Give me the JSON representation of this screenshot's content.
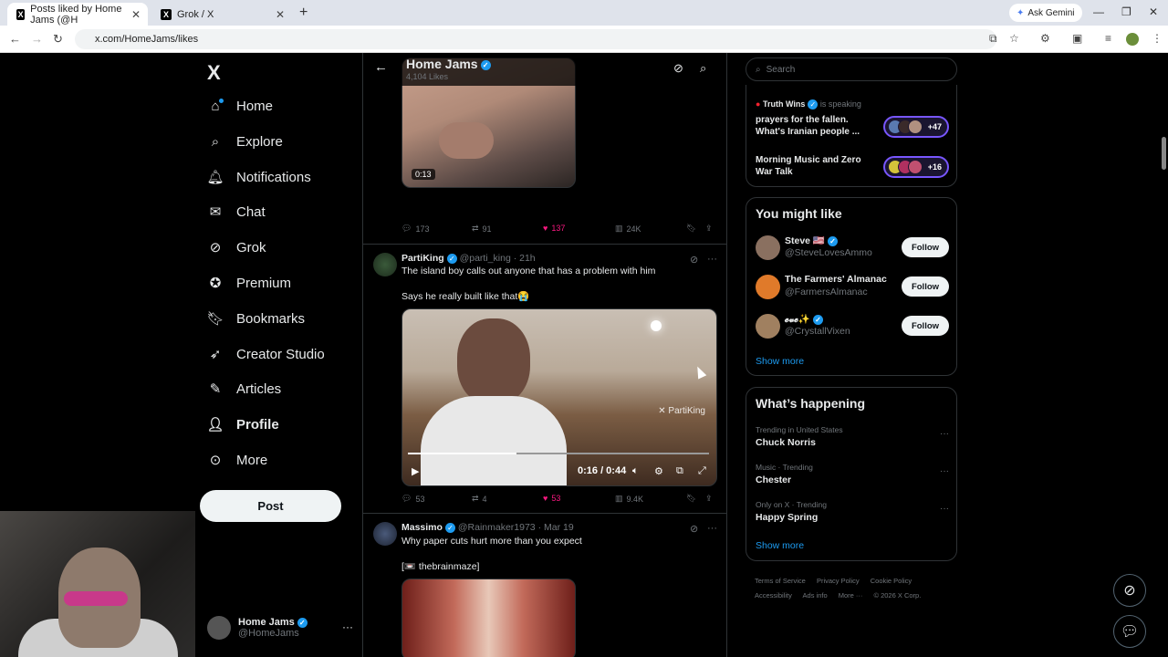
{
  "browser": {
    "tabs": [
      {
        "label": "Posts liked by Home Jams (@H"
      },
      {
        "label": "Grok / X"
      }
    ],
    "new_tab_icon": "plus-icon",
    "ask_gemini": "Ask Gemini",
    "url": "x.com/HomeJams/likes"
  },
  "nav": {
    "logo": "X",
    "items": [
      {
        "label": "Home",
        "icon": "home-icon"
      },
      {
        "label": "Explore",
        "icon": "search-icon"
      },
      {
        "label": "Notifications",
        "icon": "bell-icon"
      },
      {
        "label": "Chat",
        "icon": "mail-icon"
      },
      {
        "label": "Grok",
        "icon": "grok-icon"
      },
      {
        "label": "Premium",
        "icon": "verified-icon"
      },
      {
        "label": "Bookmarks",
        "icon": "bookmark-icon"
      },
      {
        "label": "Creator Studio",
        "icon": "rocket-icon"
      },
      {
        "label": "Articles",
        "icon": "article-icon"
      },
      {
        "label": "Profile",
        "icon": "person-icon"
      },
      {
        "label": "More",
        "icon": "more-circle-icon"
      }
    ],
    "post_button": "Post",
    "account": {
      "name": "Home Jams",
      "handle": "@HomeJams"
    }
  },
  "header": {
    "title": "Home Jams",
    "subtitle": "4,104 Likes"
  },
  "tweets": [
    {
      "duration": "0:13",
      "replies": "173",
      "reposts": "91",
      "likes": "137",
      "views": "24K"
    },
    {
      "name": "PartiKing",
      "handle": "@parti_king",
      "time": "21h",
      "text1": "The island boy calls out anyone that has a problem with him",
      "text2": "Says he really built like that😭",
      "watermark": "PartiKing",
      "time_display": "0:16 / 0:44",
      "video_progress": 0.36,
      "replies": "53",
      "reposts": "4",
      "likes": "53",
      "views": "9.4K"
    },
    {
      "name": "Massimo",
      "handle": "@Rainmaker1973",
      "time": "Mar 19",
      "text1": "Why paper cuts hurt more than you expect",
      "text2": "[📼 thebrainmaze]"
    }
  ],
  "sidebar": {
    "search_placeholder": "Search",
    "spaces": {
      "host": "Truth Wins",
      "status": "is speaking",
      "items": [
        {
          "title": "prayers for the fallen. What's Iranian people ...",
          "count": "+47"
        },
        {
          "title": "Morning Music and Zero War Talk",
          "count": "+16"
        }
      ]
    },
    "who_to_follow": {
      "title": "You might like",
      "users": [
        {
          "name": "Steve 🇺🇸",
          "handle": "@SteveLovesAmmo",
          "button": "Follow"
        },
        {
          "name": "The Farmers' Almanac",
          "handle": "@FarmersAlmanac",
          "button": "Follow"
        },
        {
          "name": "𝓮𝓿𝓮✨",
          "handle": "@CrystallVixen",
          "button": "Follow"
        }
      ],
      "show_more": "Show more"
    },
    "trends": {
      "title": "What’s happening",
      "items": [
        {
          "context": "Trending in United States",
          "name": "Chuck Norris"
        },
        {
          "context": "Music · Trending",
          "name": "Chester"
        },
        {
          "context": "Only on X · Trending",
          "name": "Happy Spring"
        }
      ],
      "show_more": "Show more"
    },
    "footer": [
      "Terms of Service",
      "Privacy Policy",
      "Cookie Policy",
      "Accessibility",
      "Ads info",
      "More ···",
      "© 2026 X Corp."
    ]
  },
  "colors": {
    "accent": "#1d9bf0",
    "like": "#f91880",
    "spaces": "#7856ff"
  }
}
